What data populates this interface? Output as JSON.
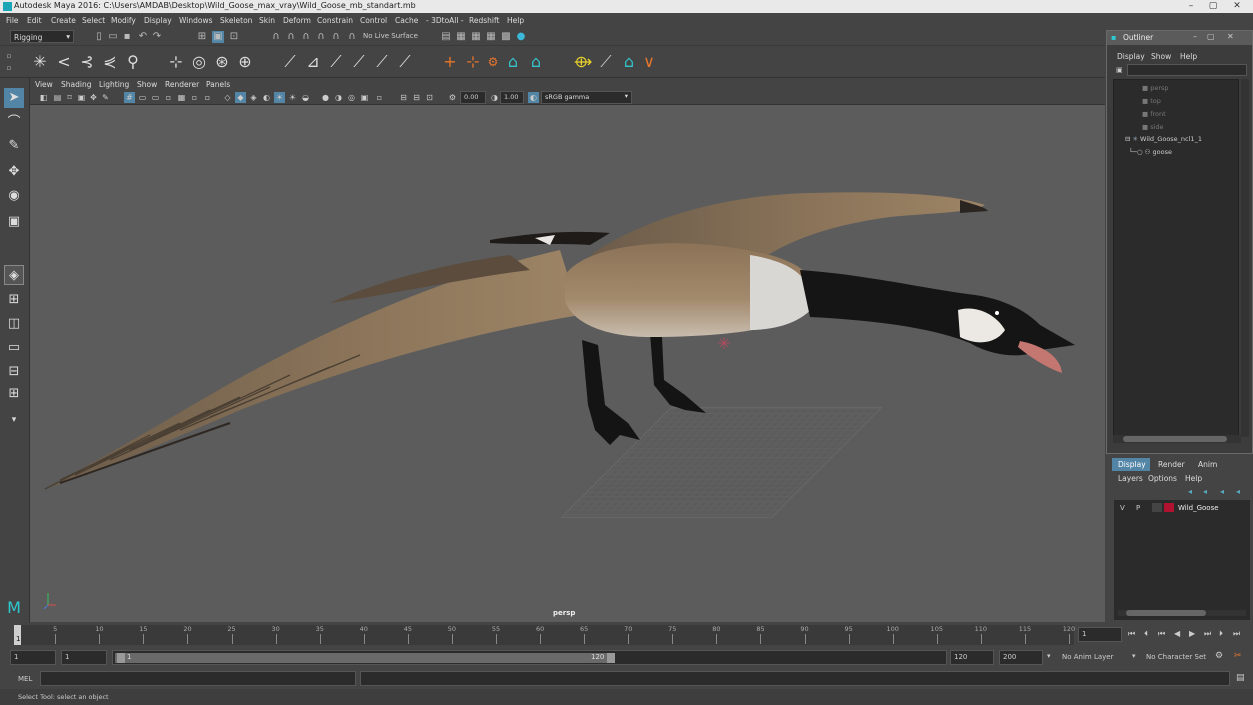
{
  "window": {
    "title": "Autodesk Maya 2016: C:\\Users\\AMDAB\\Desktop\\Wild_Goose_max_vray\\Wild_Goose_mb_standart.mb",
    "controls": [
      "–",
      "▢",
      "✕"
    ]
  },
  "menu": [
    "File",
    "Edit",
    "Create",
    "Select",
    "Modify",
    "Display",
    "Windows",
    "Skeleton",
    "Skin",
    "Deform",
    "Constrain",
    "Control",
    "Cache",
    "- 3DtoAll -",
    "Redshift",
    "Help"
  ],
  "shelf": {
    "mode": "Rigging",
    "live_surface": "No Live Surface"
  },
  "viewport": {
    "menu": [
      "View",
      "Shading",
      "Lighting",
      "Show",
      "Renderer",
      "Panels"
    ],
    "exposure": "0.00",
    "gamma": "1.00",
    "color_space": "sRGB gamma",
    "camera_label": "persp"
  },
  "outliner": {
    "title": "Outliner",
    "menu": [
      "Display",
      "Show",
      "Help"
    ],
    "items": [
      {
        "label": "persp",
        "dim": true
      },
      {
        "label": "top",
        "dim": true
      },
      {
        "label": "front",
        "dim": true
      },
      {
        "label": "side",
        "dim": true
      },
      {
        "label": "Wild_Goose_ncl1_1",
        "dim": false
      },
      {
        "label": "goose",
        "dim": false
      }
    ]
  },
  "layers": {
    "tabs": [
      "Display",
      "Render",
      "Anim"
    ],
    "menu": [
      "Layers",
      "Options",
      "Help"
    ],
    "row": {
      "v": "V",
      "p": "P",
      "name": "Wild_Goose",
      "color": "#b0122f"
    }
  },
  "timeline": {
    "ticks": [
      "5",
      "10",
      "15",
      "20",
      "25",
      "30",
      "35",
      "40",
      "45",
      "50",
      "55",
      "60",
      "65",
      "70",
      "75",
      "80",
      "85",
      "90",
      "95",
      "100",
      "105",
      "110",
      "115",
      "120"
    ],
    "current_frame": "1",
    "current_field": "1"
  },
  "range": {
    "start": "1",
    "start2": "1",
    "inner_start": "1",
    "inner_end": "120",
    "end": "120",
    "end2": "200",
    "anim_layer": "No Anim Layer",
    "char_set": "No Character Set"
  },
  "command": {
    "label": "MEL"
  },
  "help_line": "Select Tool: select an object",
  "colors": {
    "accent": "#5285a6",
    "layer": "#b0122f"
  }
}
